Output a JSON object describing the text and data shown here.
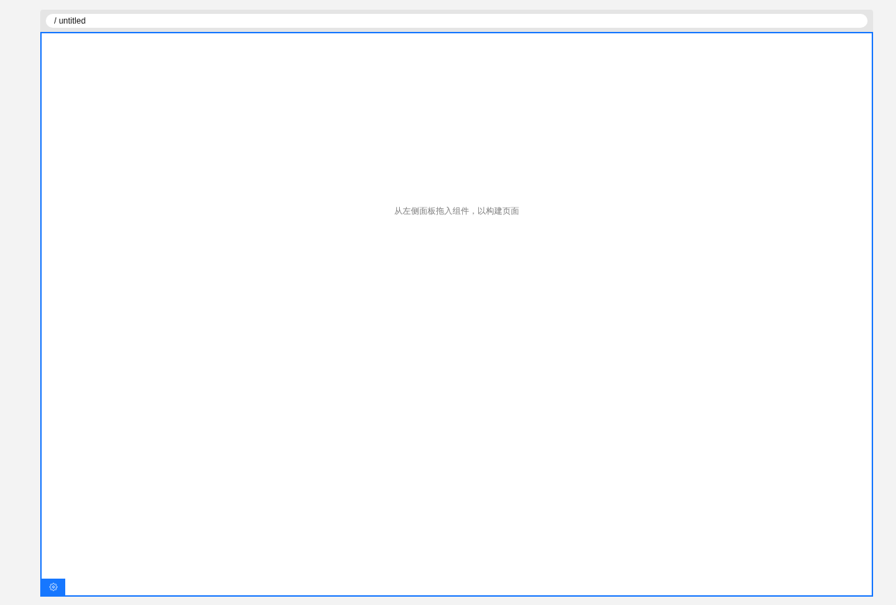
{
  "path_bar": {
    "path": "/ untitled"
  },
  "canvas": {
    "selected": true,
    "empty_hint": "从左侧面板拖入组件，以构建页面"
  }
}
